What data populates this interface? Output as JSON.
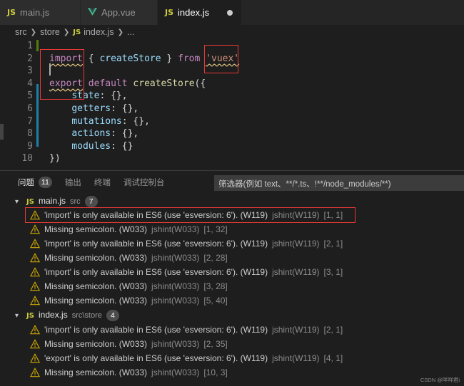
{
  "tabs": [
    {
      "icon": "JS",
      "label": "main.js"
    },
    {
      "icon": "vue-icon",
      "label": "App.vue"
    },
    {
      "icon": "JS",
      "label": "index.js",
      "dirty": true
    }
  ],
  "breadcrumb": {
    "parts": [
      "src",
      "store",
      "index.js",
      "..."
    ],
    "js_icon": "JS"
  },
  "editor": {
    "line_numbers": [
      "1",
      "2",
      "3",
      "4",
      "5",
      "6",
      "7",
      "8",
      "9",
      "10"
    ],
    "lines": [
      "",
      "import { createStore } from 'vuex'",
      "",
      "export default createStore({",
      "    state: {},",
      "    getters: {},",
      "    mutations: {},",
      "    actions: {},",
      "    modules: {}",
      "})"
    ],
    "tokens": {
      "l2": {
        "import": "import",
        "open": " { ",
        "fn": "createStore",
        "close": " } ",
        "from": "from",
        "sp": " ",
        "str": "'vuex'"
      },
      "l4": {
        "export": "export",
        "default": " default ",
        "fn": "createStore",
        "rest": "({"
      },
      "l5": {
        "prop": "state",
        "rest": ": {},"
      },
      "l6": {
        "prop": "getters",
        "rest": ": {},"
      },
      "l7": {
        "prop": "mutations",
        "rest": ": {},"
      },
      "l8": {
        "prop": "actions",
        "rest": ": {},"
      },
      "l9": {
        "prop": "modules",
        "rest": ": {}"
      },
      "l10": {
        "rest": "})"
      }
    }
  },
  "panel": {
    "tabs": [
      {
        "label": "问题",
        "count": "11"
      },
      {
        "label": "输出"
      },
      {
        "label": "终端"
      },
      {
        "label": "调试控制台"
      }
    ],
    "filter_placeholder": "筛选器(例如 text、**/*.ts、!**/node_modules/**)",
    "groups": [
      {
        "file": "main.js",
        "path": "src",
        "count": "7",
        "items": [
          {
            "msg": "'import' is only available in ES6 (use 'esversion: 6'). (W119)",
            "src": "jshint(W119)",
            "pos": "[1, 1]"
          },
          {
            "msg": "Missing semicolon. (W033)",
            "src": "jshint(W033)",
            "pos": "[1, 32]"
          },
          {
            "msg": "'import' is only available in ES6 (use 'esversion: 6'). (W119)",
            "src": "jshint(W119)",
            "pos": "[2, 1]"
          },
          {
            "msg": "Missing semicolon. (W033)",
            "src": "jshint(W033)",
            "pos": "[2, 28]"
          },
          {
            "msg": "'import' is only available in ES6 (use 'esversion: 6'). (W119)",
            "src": "jshint(W119)",
            "pos": "[3, 1]"
          },
          {
            "msg": "Missing semicolon. (W033)",
            "src": "jshint(W033)",
            "pos": "[3, 28]"
          },
          {
            "msg": "Missing semicolon. (W033)",
            "src": "jshint(W033)",
            "pos": "[5, 40]"
          }
        ]
      },
      {
        "file": "index.js",
        "path": "src\\store",
        "count": "4",
        "items": [
          {
            "msg": "'import' is only available in ES6 (use 'esversion: 6'). (W119)",
            "src": "jshint(W119)",
            "pos": "[2, 1]"
          },
          {
            "msg": "Missing semicolon. (W033)",
            "src": "jshint(W033)",
            "pos": "[2, 35]"
          },
          {
            "msg": "'export' is only available in ES6 (use 'esversion: 6'). (W119)",
            "src": "jshint(W119)",
            "pos": "[4, 1]"
          },
          {
            "msg": "Missing semicolon. (W033)",
            "src": "jshint(W033)",
            "pos": "[10, 3]"
          }
        ]
      }
    ]
  },
  "watermark": "CSDN @咩咩君i",
  "colors": {
    "warning": "#cca700",
    "highlight_box": "#e53935",
    "keyword": "#c586c0",
    "string": "#ce9178"
  }
}
